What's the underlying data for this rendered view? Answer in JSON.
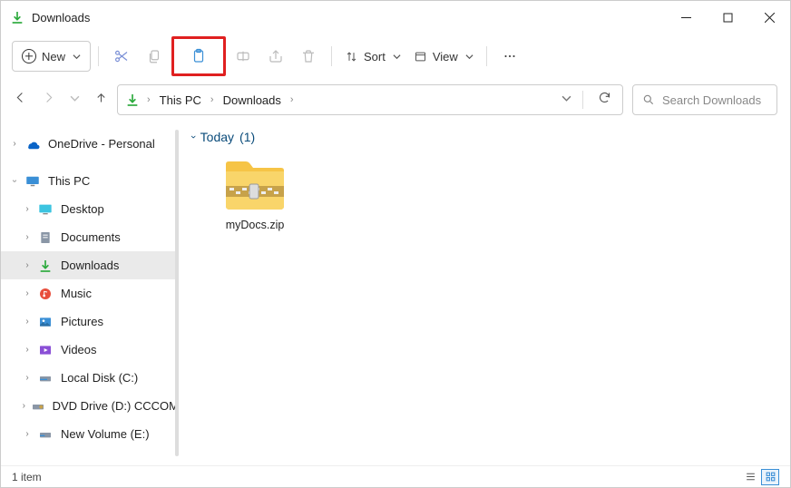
{
  "title": "Downloads",
  "toolbar": {
    "new_label": "New",
    "sort_label": "Sort",
    "view_label": "View"
  },
  "breadcrumb": {
    "root": "This PC",
    "current": "Downloads"
  },
  "search": {
    "placeholder": "Search Downloads"
  },
  "sidebar": {
    "onedrive": "OneDrive - Personal",
    "thispc": "This PC",
    "items": [
      "Desktop",
      "Documents",
      "Downloads",
      "Music",
      "Pictures",
      "Videos",
      "Local Disk (C:)",
      "DVD Drive (D:) CCCOM",
      "New Volume (E:)"
    ]
  },
  "content": {
    "group_label": "Today",
    "group_count": "(1)",
    "files": [
      {
        "name": "myDocs.zip"
      }
    ]
  },
  "status": {
    "count": "1 item"
  }
}
